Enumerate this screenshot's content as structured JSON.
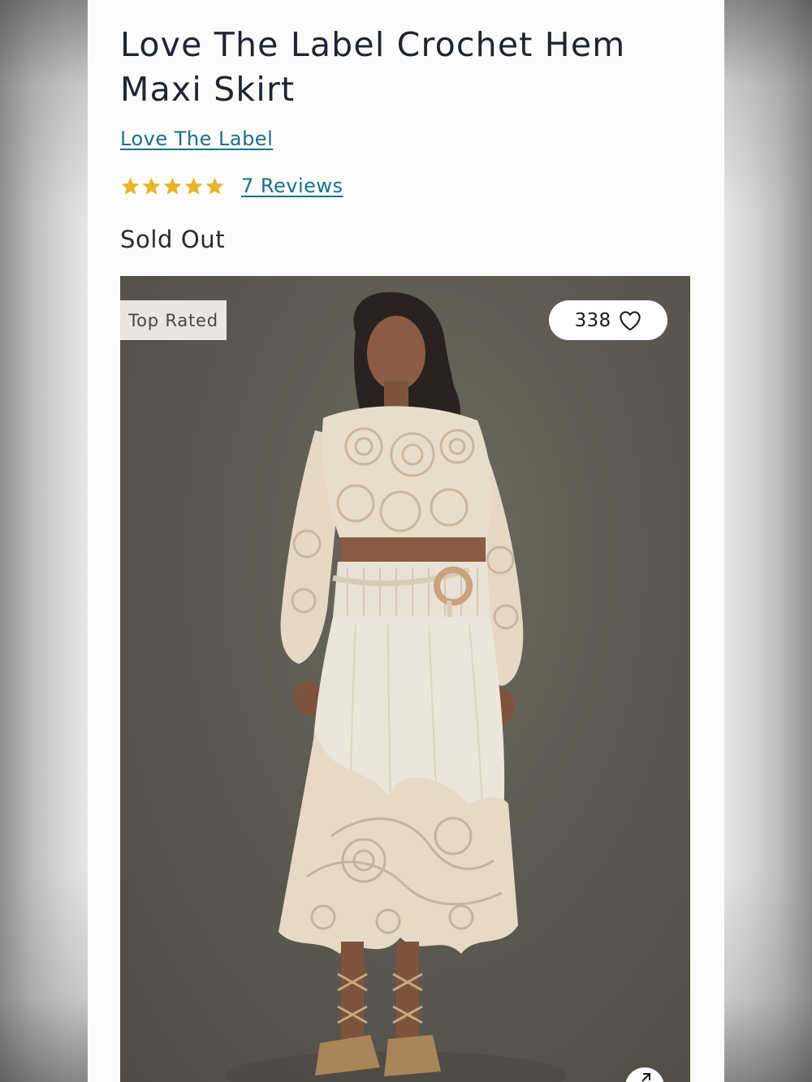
{
  "product": {
    "title": "Love The Label Crochet Hem Maxi Skirt",
    "brand": "Love The Label",
    "rating": {
      "stars": 5,
      "max_stars": 5,
      "reviews_label": "7 Reviews"
    },
    "stock_status": "Sold Out"
  },
  "gallery": {
    "badge": "Top Rated",
    "favorites_count": "338",
    "icons": {
      "favorite": "heart-icon",
      "zoom": "expand-icon",
      "rating": "star-icon"
    }
  },
  "colors": {
    "link": "#1d6f8c",
    "star": "#e5b52a",
    "title": "#1f2430",
    "photo_background": "#5d5a51",
    "garment": "#e8dccb"
  }
}
